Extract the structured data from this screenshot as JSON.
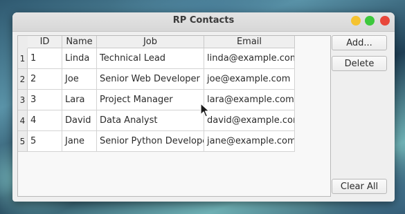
{
  "window": {
    "title": "RP Contacts"
  },
  "table": {
    "headers": [
      "ID",
      "Name",
      "Job",
      "Email"
    ],
    "row_numbers": [
      "1",
      "2",
      "3",
      "4",
      "5"
    ],
    "rows": [
      {
        "id": "1",
        "name": "Linda",
        "job": "Technical Lead",
        "email": "linda@example.com"
      },
      {
        "id": "2",
        "name": "Joe",
        "job": "Senior Web Developer",
        "email": "joe@example.com"
      },
      {
        "id": "3",
        "name": "Lara",
        "job": "Project Manager",
        "email": "lara@example.com"
      },
      {
        "id": "4",
        "name": "David",
        "job": "Data Analyst",
        "email": "david@example.com"
      },
      {
        "id": "5",
        "name": "Jane",
        "job": "Senior Python Developer",
        "email": "jane@example.com"
      }
    ]
  },
  "buttons": {
    "add": "Add...",
    "delete": "Delete",
    "clear_all": "Clear All"
  },
  "colors": {
    "minimize": "#f5c330",
    "maximize": "#3cc83c",
    "close": "#e8473a"
  }
}
